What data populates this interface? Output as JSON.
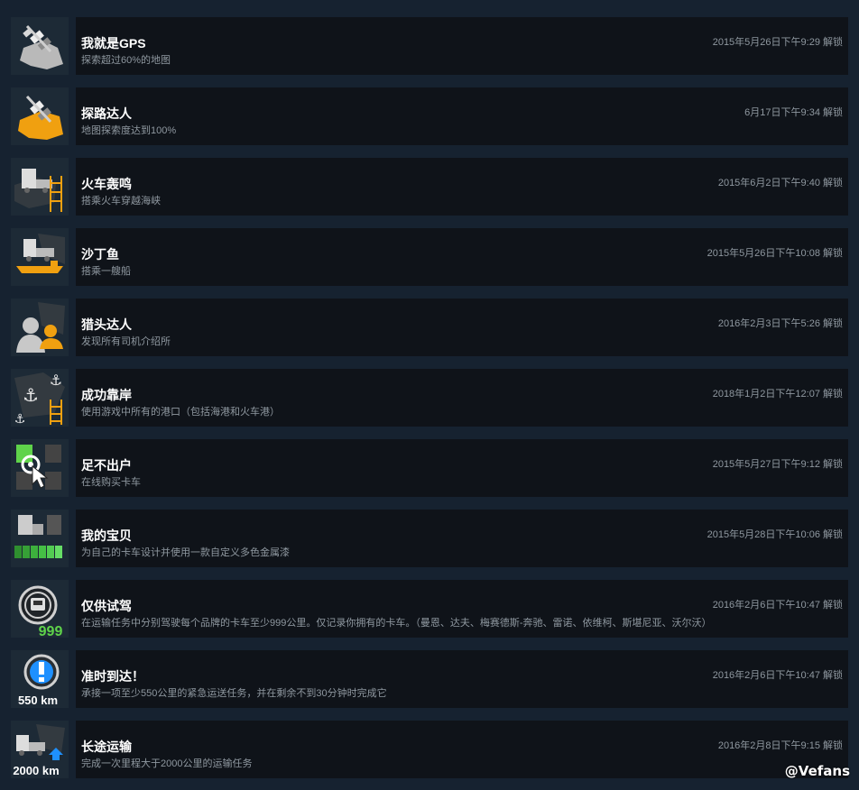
{
  "achievements": [
    {
      "title": "我就是GPS",
      "desc": "探索超过60%的地图",
      "date": "2015年5月26日下午9:29 解锁",
      "icon": "satellite-map-silver-icon"
    },
    {
      "title": "探路达人",
      "desc": "地图探索度达到100%",
      "date": "6月17日下午9:34 解锁",
      "icon": "satellite-map-gold-icon"
    },
    {
      "title": "火车轰鸣",
      "desc": "搭乘火车穿越海峡",
      "date": "2015年6月2日下午9:40 解锁",
      "icon": "truck-rail-icon"
    },
    {
      "title": "沙丁鱼",
      "desc": "搭乘一艘船",
      "date": "2015年5月26日下午10:08 解锁",
      "icon": "truck-ferry-icon"
    },
    {
      "title": "猎头达人",
      "desc": "发现所有司机介绍所",
      "date": "2016年2月3日下午5:26 解锁",
      "icon": "driver-silhouettes-icon"
    },
    {
      "title": "成功靠岸",
      "desc": "使用游戏中所有的港口（包括海港和火车港）",
      "date": "2018年1月2日下午12:07 解锁",
      "icon": "anchors-rail-icon"
    },
    {
      "title": "足不出户",
      "desc": "在线购买卡车",
      "date": "2015年5月27日下午9:12 解锁",
      "icon": "truck-select-cursor-icon"
    },
    {
      "title": "我的宝贝",
      "desc": "为自己的卡车设计并使用一款自定义多色金属漆",
      "date": "2015年5月28日下午10:06 解锁",
      "icon": "truck-paint-icon"
    },
    {
      "title": "仅供试驾",
      "desc": "在运输任务中分别驾驶每个品牌的卡车至少999公里。仅记录你拥有的卡车。（曼恩、达夫、梅赛德斯-奔驰、雷诺、依维柯、斯堪尼亚、沃尔沃）",
      "date": "2016年2月6日下午10:47 解锁",
      "icon": "truck-badge-999-icon",
      "badge": "999"
    },
    {
      "title": "准时到达！",
      "desc": "承接一项至少550公里的紧急运送任务，并在剩余不到30分钟时完成它",
      "date": "2016年2月6日下午10:47 解锁",
      "icon": "urgent-550km-icon",
      "badge": "550 km"
    },
    {
      "title": "长途运输",
      "desc": "完成一次里程大于2000公里的运输任务",
      "date": "2016年2月8日下午9:15 解锁",
      "icon": "truck-2000km-icon",
      "badge": "2000 km"
    }
  ],
  "watermark": "@Vefans",
  "colors": {
    "background": "#162230",
    "panel": "#0f1319",
    "title": "#ffffff",
    "meta": "#8f98a0",
    "gold": "#f0a010",
    "green": "#5fd34a",
    "blue": "#1e90ff"
  }
}
